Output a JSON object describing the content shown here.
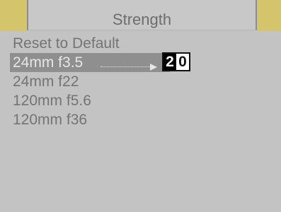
{
  "header": {
    "title": "Strength"
  },
  "menu": {
    "items": [
      {
        "label": "Reset to Default"
      },
      {
        "label": "24mm f3.5"
      },
      {
        "label": "24mm f22"
      },
      {
        "label": "120mm f5.6"
      },
      {
        "label": "120mm f36"
      }
    ],
    "selected_index": 1,
    "value_digits": [
      "2",
      "0"
    ],
    "active_digit_index": 0
  },
  "colors": {
    "background": "#c3c3c3",
    "accent_tab": "#d4c56c",
    "selection": "#8f8f8f",
    "text": "#747474"
  }
}
